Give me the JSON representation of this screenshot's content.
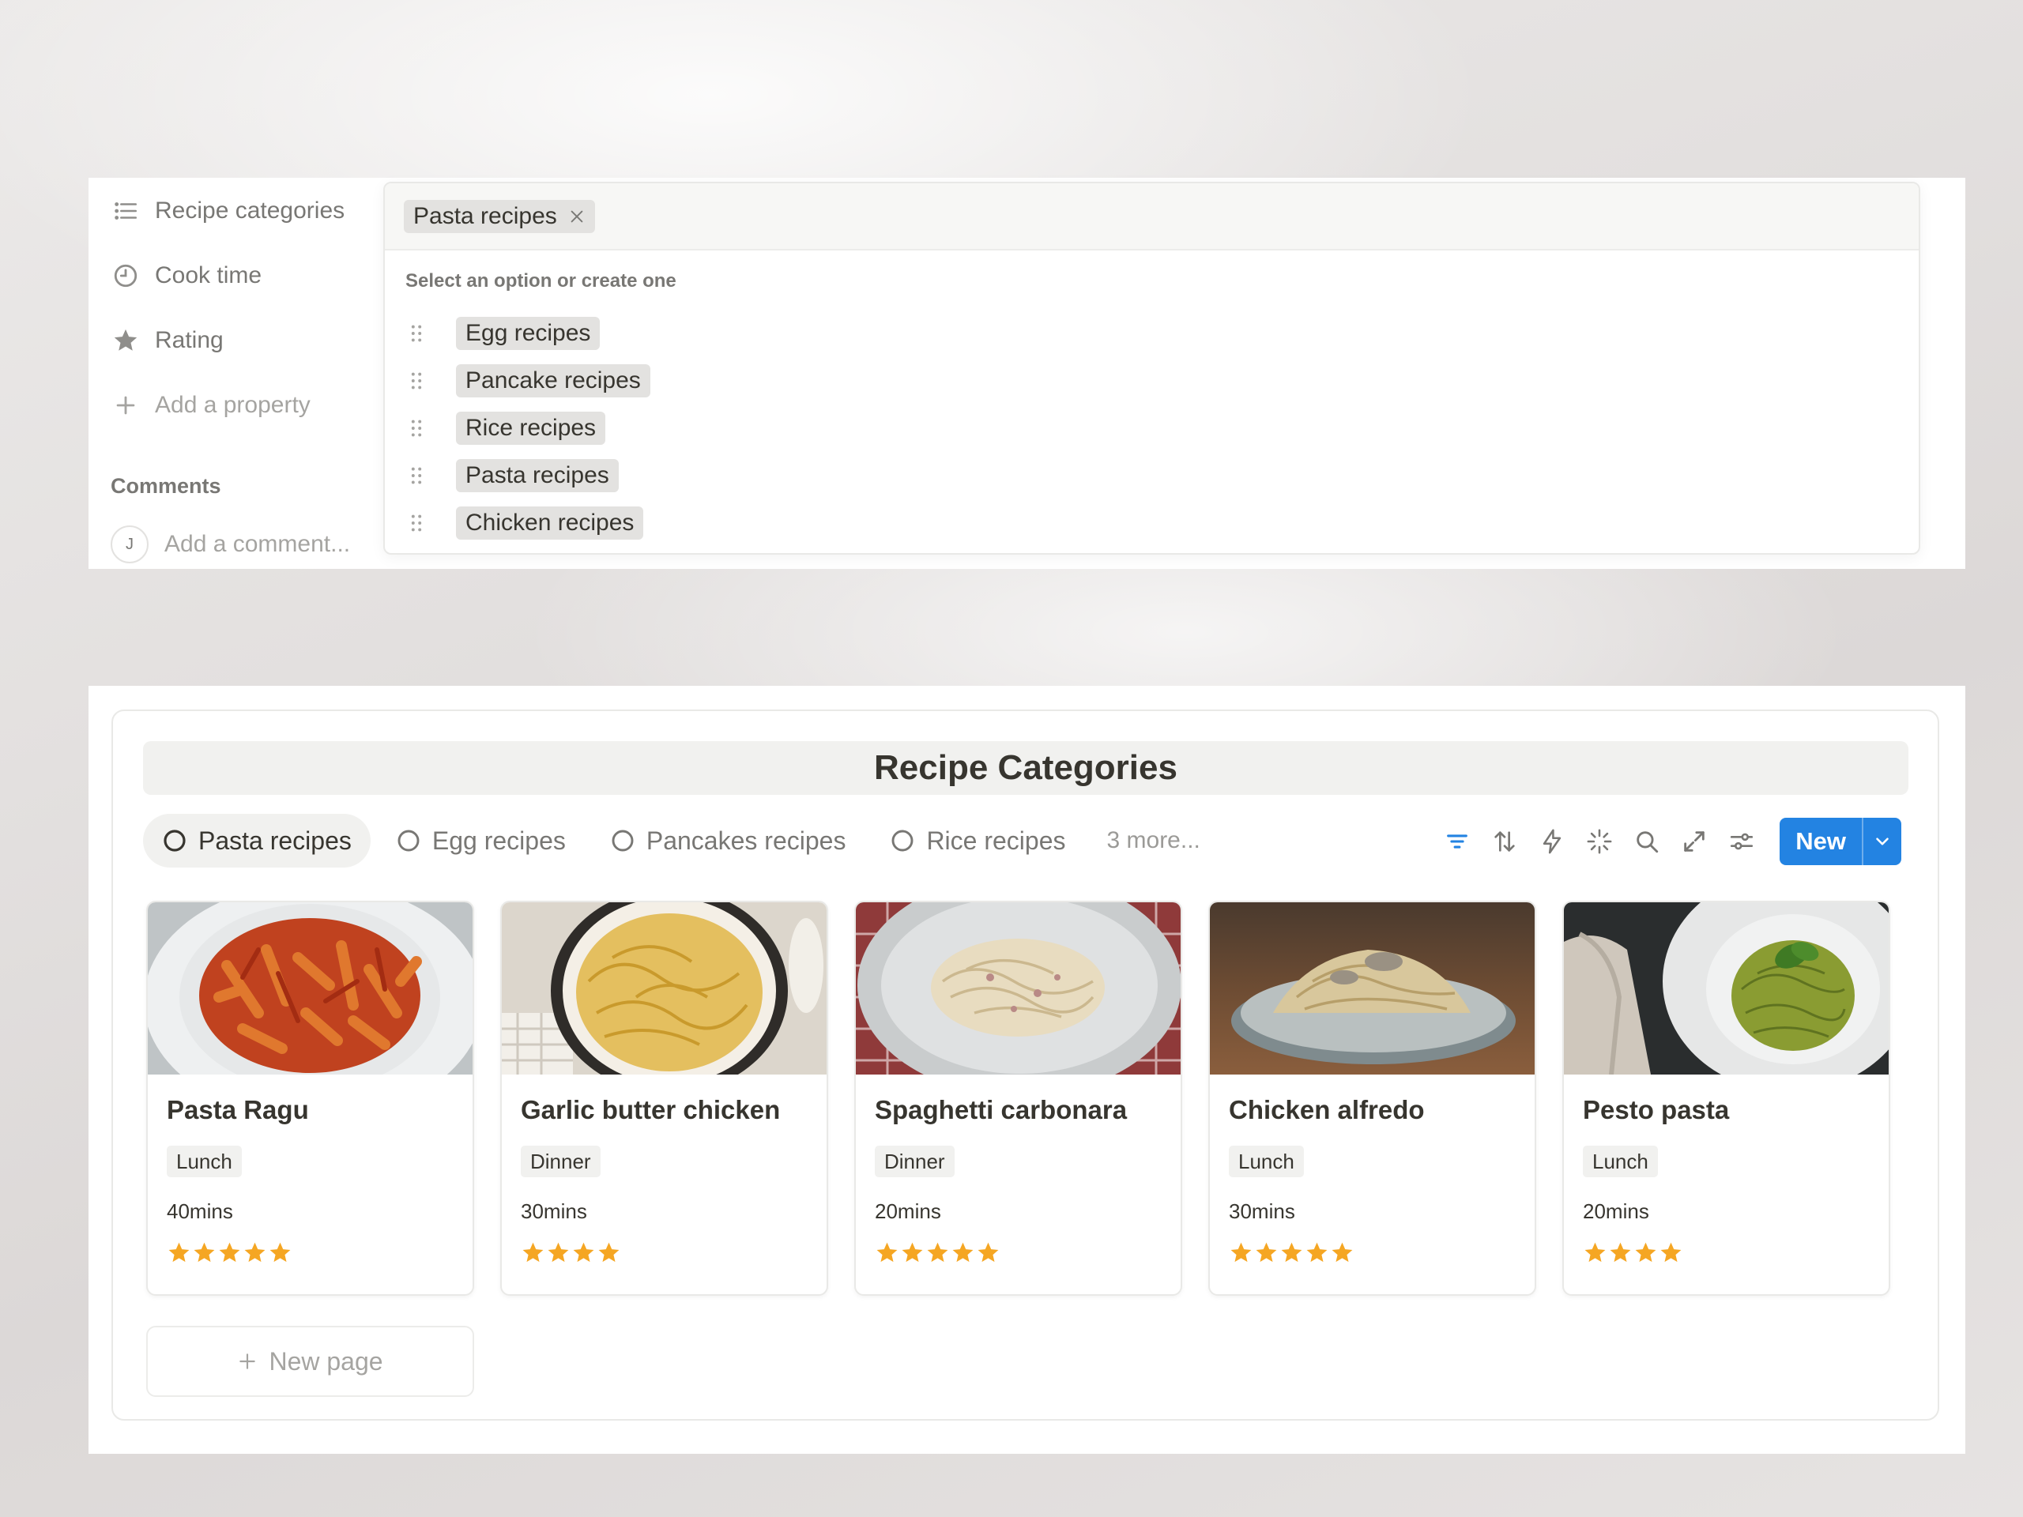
{
  "properties_panel": {
    "properties": [
      {
        "label": "Recipe categories",
        "icon": "list-icon"
      },
      {
        "label": "Cook time",
        "icon": "clock-icon"
      },
      {
        "label": "Rating",
        "icon": "star-icon"
      }
    ],
    "add_property_label": "Add a property",
    "comments_title": "Comments",
    "avatar_initial": "J",
    "comment_placeholder": "Add a comment..."
  },
  "select_dropdown": {
    "selected": "Pasta recipes",
    "hint": "Select an option or create one",
    "options": [
      "Egg recipes",
      "Pancake recipes",
      "Rice recipes",
      "Pasta recipes",
      "Chicken recipes"
    ]
  },
  "board": {
    "title": "Recipe Categories",
    "tabs": [
      "Pasta recipes",
      "Egg recipes",
      "Pancakes recipes",
      "Rice recipes"
    ],
    "active_tab": "Pasta recipes",
    "more_label": "3 more...",
    "toolbar_icons": [
      "filter-icon",
      "sort-icon",
      "automation-icon",
      "ai-sparkle-icon",
      "search-icon",
      "expand-icon",
      "settings-icon"
    ],
    "new_button_label": "New",
    "accent_color": "#2383e2",
    "star_color": "#f5a623",
    "cards": [
      {
        "title": "Pasta Ragu",
        "meal": "Lunch",
        "time": "40mins",
        "rating": 5,
        "image": "penne-ragu-photo"
      },
      {
        "title": "Garlic butter chicken",
        "meal": "Dinner",
        "time": "30mins",
        "rating": 4,
        "image": "spaghetti-pan-photo"
      },
      {
        "title": "Spaghetti carbonara",
        "meal": "Dinner",
        "time": "20mins",
        "rating": 5,
        "image": "carbonara-plate-photo"
      },
      {
        "title": "Chicken alfredo",
        "meal": "Lunch",
        "time": "30mins",
        "rating": 5,
        "image": "alfredo-bowl-photo"
      },
      {
        "title": "Pesto pasta",
        "meal": "Lunch",
        "time": "20mins",
        "rating": 4,
        "image": "pesto-plate-photo"
      }
    ],
    "new_page_label": "New page"
  }
}
